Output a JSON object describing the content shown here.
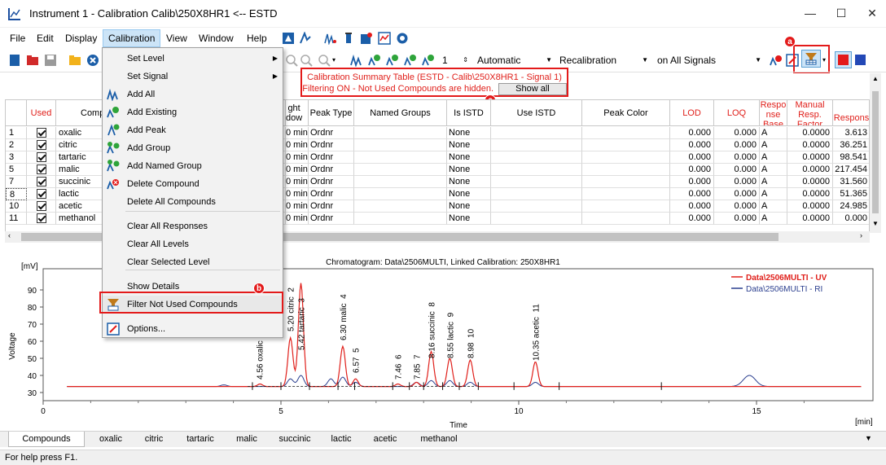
{
  "window": {
    "title": "Instrument 1 - Calibration Calib\\250X8HR1 <-- ESTD",
    "minimize": "—",
    "maximize": "☐",
    "close": "✕"
  },
  "menubar": [
    "File",
    "Edit",
    "Display",
    "Calibration",
    "View",
    "Window",
    "Help"
  ],
  "toolbar": {
    "level_value": "1",
    "mode_value": "Automatic",
    "recalibration_value": "Recalibration",
    "signal_value": "on All Signals"
  },
  "summary": {
    "line1": "Calibration Summary Table (ESTD - Calib\\250X8HR1 - Signal 1)",
    "line2": "Filtering ON - Not Used Compounds are hidden.",
    "show_all": "Show all"
  },
  "dropdown": {
    "items": [
      {
        "label": "Set Level",
        "icon": "none",
        "submenu": true
      },
      {
        "label": "Set Signal",
        "icon": "none",
        "submenu": true
      },
      {
        "label": "Add All",
        "icon": "add-all-icon"
      },
      {
        "label": "Add Existing",
        "icon": "add-existing-icon"
      },
      {
        "label": "Add Peak",
        "icon": "add-peak-icon"
      },
      {
        "label": "Add Group",
        "icon": "add-group-icon"
      },
      {
        "label": "Add Named Group",
        "icon": "add-named-group-icon"
      },
      {
        "label": "Delete Compound",
        "icon": "delete-compound-icon"
      },
      {
        "label": "Delete All Compounds",
        "icon": "none"
      },
      {
        "label": "Clear All Responses",
        "icon": "none"
      },
      {
        "label": "Clear All Levels",
        "icon": "none"
      },
      {
        "label": "Clear Selected Level",
        "icon": "none"
      },
      {
        "label": "Show Details",
        "icon": "none"
      },
      {
        "label": "Filter Not Used Compounds",
        "icon": "filter-icon"
      },
      {
        "label": "Options...",
        "icon": "options-icon"
      }
    ]
  },
  "callouts": {
    "a": "a",
    "b": "b",
    "c": "c"
  },
  "grid": {
    "headers": {
      "used": "Used",
      "compound": "Comp",
      "window": "ght\ndow",
      "peak_type": "Peak Type",
      "named_groups": "Named Groups",
      "is_istd": "Is ISTD",
      "use_istd": "Use ISTD",
      "peak_color": "Peak Color",
      "lod": "LOD",
      "loq": "LOQ",
      "response_base": "Respo\nnse\nBase",
      "manual_resp": "Manual\nResp.\nFactor",
      "response": "Respons"
    },
    "rows": [
      {
        "num": "1",
        "name": "oxalic",
        "win": "0 min",
        "ptype": "Ordnr",
        "istd": "None",
        "lod": "0.000",
        "loq": "0.000",
        "base": "A",
        "manual": "0.0000",
        "resp": "3.613"
      },
      {
        "num": "2",
        "name": "citric",
        "win": "0 min",
        "ptype": "Ordnr",
        "istd": "None",
        "lod": "0.000",
        "loq": "0.000",
        "base": "A",
        "manual": "0.0000",
        "resp": "36.251"
      },
      {
        "num": "3",
        "name": "tartaric",
        "win": "0 min",
        "ptype": "Ordnr",
        "istd": "None",
        "lod": "0.000",
        "loq": "0.000",
        "base": "A",
        "manual": "0.0000",
        "resp": "98.541"
      },
      {
        "num": "5",
        "name": "malic",
        "win": "0 min",
        "ptype": "Ordnr",
        "istd": "None",
        "lod": "0.000",
        "loq": "0.000",
        "base": "A",
        "manual": "0.0000",
        "resp": "217.454"
      },
      {
        "num": "7",
        "name": "succinic",
        "win": "0 min",
        "ptype": "Ordnr",
        "istd": "None",
        "lod": "0.000",
        "loq": "0.000",
        "base": "A",
        "manual": "0.0000",
        "resp": "31.560"
      },
      {
        "num": "8",
        "name": "lactic",
        "win": "0 min",
        "ptype": "Ordnr",
        "istd": "None",
        "lod": "0.000",
        "loq": "0.000",
        "base": "A",
        "manual": "0.0000",
        "resp": "51.365"
      },
      {
        "num": "10",
        "name": "acetic",
        "win": "0 min",
        "ptype": "Ordnr",
        "istd": "None",
        "lod": "0.000",
        "loq": "0.000",
        "base": "A",
        "manual": "0.0000",
        "resp": "24.985"
      },
      {
        "num": "11",
        "name": "methanol",
        "win": "0 min",
        "ptype": "Ordnr",
        "istd": "None",
        "lod": "0.000",
        "loq": "0.000",
        "base": "A",
        "manual": "0.0000",
        "resp": "0.000"
      }
    ]
  },
  "chart": {
    "title": "Chromatogram: Data\\2506MULTI, Linked Calibration: 250X8HR1",
    "yunit": "[mV]",
    "ylabel": "Voltage",
    "xlabel": "Time",
    "xunit": "[min]",
    "yticks": [
      "90",
      "80",
      "70",
      "60",
      "50",
      "40",
      "30"
    ],
    "xticks": [
      "0",
      "5",
      "10",
      "15"
    ],
    "legend": [
      {
        "label": "Data\\2506MULTI - UV",
        "color": "#e0201b"
      },
      {
        "label": "Data\\2506MULTI - RI",
        "color": "#2b3f8f"
      }
    ],
    "peak_labels": [
      "4.56 oxalic",
      "5.20 citric  2",
      "5.42 tartaric  3",
      "6.30 malic  4",
      "6.57  5",
      "7.46  6",
      "7.85  7",
      "8.16 succinic  8",
      "8.55 lactic  9",
      "8.98  10",
      "10.35 acetic  11"
    ]
  },
  "chart_data": {
    "type": "line",
    "title": "Chromatogram: Data\\2506MULTI, Linked Calibration: 250X8HR1",
    "xlabel": "Time",
    "ylabel": "Voltage",
    "xlim": [
      0,
      17.5
    ],
    "ylim": [
      27,
      96
    ],
    "series": [
      {
        "name": "Data\\2506MULTI - UV",
        "color": "#e0201b",
        "peaks": [
          [
            4.56,
            35
          ],
          [
            5.2,
            62
          ],
          [
            5.42,
            94
          ],
          [
            6.3,
            57
          ],
          [
            6.57,
            38
          ],
          [
            7.46,
            35
          ],
          [
            7.85,
            36
          ],
          [
            8.16,
            54
          ],
          [
            8.55,
            50
          ],
          [
            8.98,
            49
          ],
          [
            10.35,
            48
          ]
        ],
        "baseline": 33.5
      },
      {
        "name": "Data\\2506MULTI - RI",
        "color": "#2b3f8f",
        "peaks": [
          [
            3.8,
            34.5
          ],
          [
            5.2,
            38
          ],
          [
            5.42,
            40
          ],
          [
            6.05,
            38
          ],
          [
            6.3,
            39
          ],
          [
            6.57,
            36
          ],
          [
            7.85,
            36
          ],
          [
            8.16,
            37
          ],
          [
            8.55,
            37
          ],
          [
            8.98,
            36
          ],
          [
            10.35,
            36
          ],
          [
            14.85,
            40
          ]
        ],
        "baseline": 33.5
      }
    ]
  },
  "tabs": [
    "Compounds",
    "oxalic",
    "citric",
    "tartaric",
    "malic",
    "succinic",
    "lactic",
    "acetic",
    "methanol"
  ],
  "status": "For help press F1."
}
